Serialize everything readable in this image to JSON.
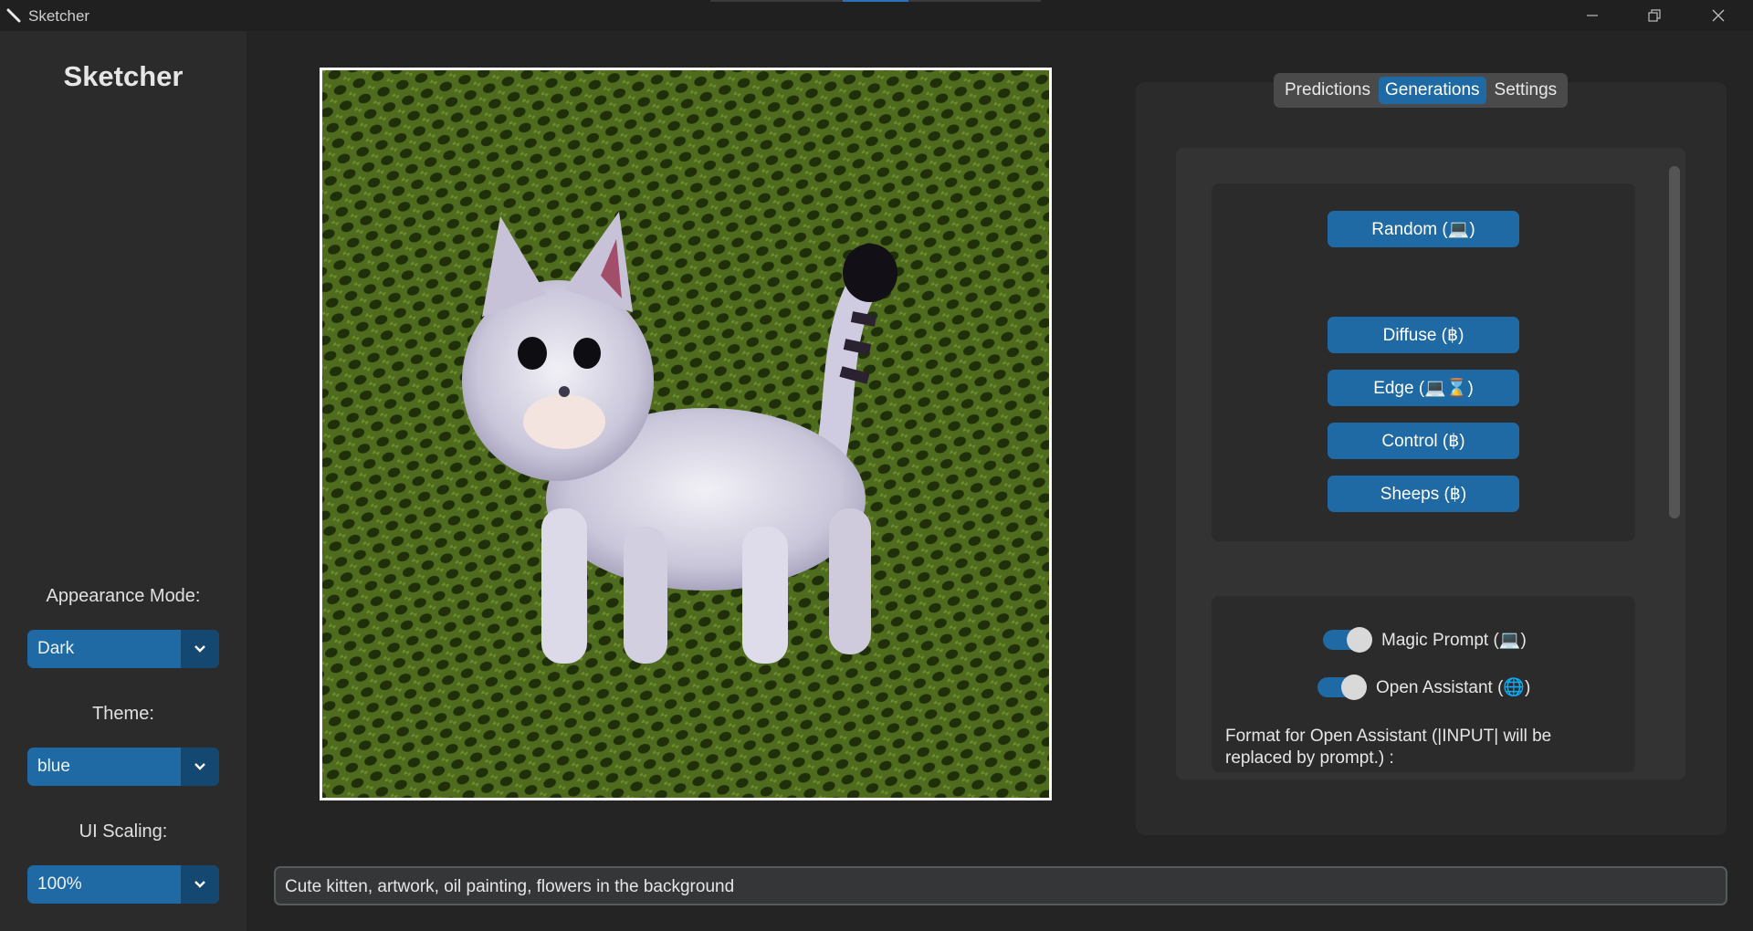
{
  "window": {
    "title": "Sketcher",
    "accent_color": "#1f6aa5"
  },
  "sidebar": {
    "logo": "Sketcher",
    "appearance_label": "Appearance Mode:",
    "appearance_value": "Dark",
    "theme_label": "Theme:",
    "theme_value": "blue",
    "scaling_label": "UI Scaling:",
    "scaling_value": "100%"
  },
  "canvas": {
    "description_icon": "generated-image-kitten"
  },
  "tabs": {
    "items": [
      "Predictions",
      "Generations",
      "Settings"
    ],
    "selected": "Generations"
  },
  "generations": {
    "random_label": "Random (💻)",
    "diffuse_label": "Diffuse (฿)",
    "edge_label": "Edge (💻⌛)",
    "control_label": "Control (฿)",
    "sheeps_label": "Sheeps (฿)",
    "magic_prompt_label": "Magic Prompt (💻)",
    "magic_prompt_on": true,
    "open_assistant_label": "Open Assistant (🌐)",
    "open_assistant_on": true,
    "format_text": "Format for Open Assistant (|INPUT| will be replaced by prompt.) :"
  },
  "prompt": {
    "value": "Cute kitten, artwork, oil painting, flowers in the background"
  }
}
